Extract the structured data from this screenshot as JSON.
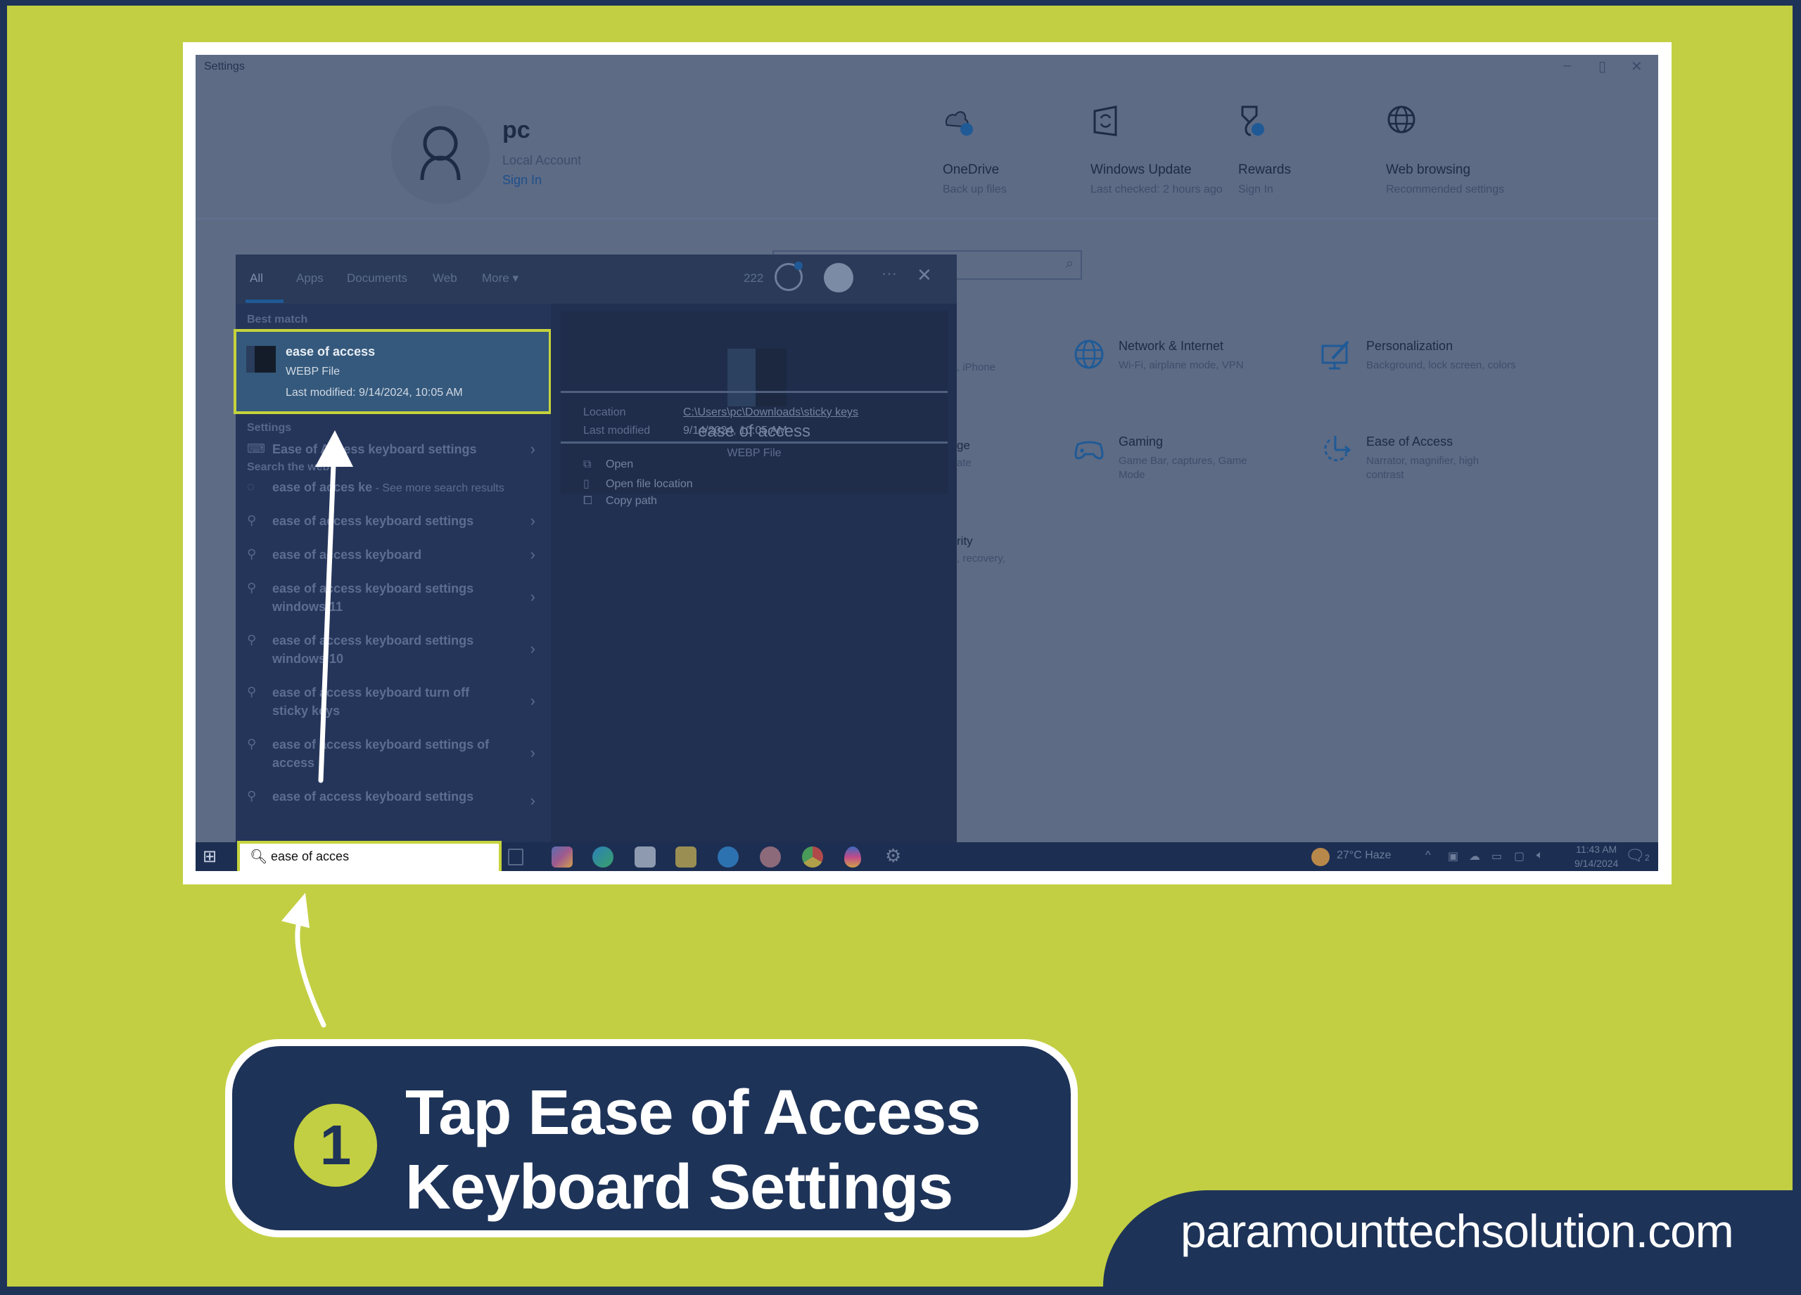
{
  "settings_window": {
    "title": "Settings",
    "controls": {
      "minimize": "–",
      "maximize": "▯",
      "close": "✕"
    },
    "account": {
      "name": "pc",
      "type": "Local Account",
      "sign_in": "Sign In"
    },
    "quick_tiles": [
      {
        "icon": "onedrive-icon",
        "title": "OneDrive",
        "subtitle": "Back up files"
      },
      {
        "icon": "windows-update-icon",
        "title": "Windows Update",
        "subtitle": "Last checked: 2 hours ago"
      },
      {
        "icon": "rewards-icon",
        "title": "Rewards",
        "subtitle": "Sign In"
      },
      {
        "icon": "web-browsing-icon",
        "title": "Web browsing",
        "subtitle": "Recommended settings"
      }
    ],
    "categories": [
      {
        "icon": "globe-icon",
        "title": "Network & Internet",
        "subtitle": "Wi-Fi, airplane mode, VPN"
      },
      {
        "icon": "personalization-icon",
        "title": "Personalization",
        "subtitle": "Background, lock screen, colors"
      },
      {
        "icon": "gamepad-icon",
        "title": "Gaming",
        "subtitle": "Game Bar, captures, Game Mode"
      },
      {
        "icon": "ease-of-access-icon",
        "title": "Ease of Access",
        "subtitle": "Narrator, magnifier, high contrast"
      }
    ],
    "partial_texts": {
      "phone": ", iPhone",
      "apps_title": "ge",
      "apps_sub": "ate",
      "security_title": "rity",
      "security_sub": ", recovery,"
    }
  },
  "search_panel": {
    "tabs": [
      {
        "label": "All",
        "active": true
      },
      {
        "label": "Apps"
      },
      {
        "label": "Documents"
      },
      {
        "label": "Web"
      },
      {
        "label": "More ▾"
      }
    ],
    "points": "222",
    "more_label": "···",
    "close_label": "✕",
    "best_match_header": "Best match",
    "best_match": {
      "title": "ease of access",
      "type": "WEBP File",
      "modified": "Last modified: 9/14/2024, 10:05 AM"
    },
    "settings_header": "Settings",
    "settings_results": [
      {
        "icon": "keyboard-icon",
        "label": "Ease of Access keyboard settings"
      }
    ],
    "web_header": "Search the web",
    "web_results": [
      {
        "icon": "bing-chat-icon",
        "label": "ease of acces ke",
        "suffix": " - See more search results"
      },
      {
        "icon": "search-icon",
        "label": "ease of access keyboard settings"
      },
      {
        "icon": "search-icon",
        "label": "ease of access keyboard"
      },
      {
        "icon": "search-icon",
        "label": "ease of access keyboard settings windows 11"
      },
      {
        "icon": "search-icon",
        "label": "ease of access keyboard settings windows 10"
      },
      {
        "icon": "search-icon",
        "label": "ease of access keyboard turn off sticky keys"
      },
      {
        "icon": "search-icon",
        "label": "ease of access keyboard settings of access"
      },
      {
        "icon": "search-icon",
        "label": "ease of access keyboard settings"
      }
    ],
    "preview": {
      "name": "ease of access",
      "type": "WEBP File",
      "location_label": "Location",
      "location_value": "C:\\Users\\pc\\Downloads\\sticky keys",
      "modified_label": "Last modified",
      "modified_value": "9/14/2024, 10:05 AM",
      "actions": [
        {
          "icon": "open-icon",
          "label": "Open"
        },
        {
          "icon": "folder-location-icon",
          "label": "Open file location"
        },
        {
          "icon": "copy-icon",
          "label": "Copy path"
        }
      ]
    }
  },
  "taskbar": {
    "search_value": "ease of acces",
    "apps": [
      "task-view-icon",
      "copilot-icon",
      "edge-icon",
      "mail-icon",
      "file-explorer-icon",
      "skype-icon",
      "app-icon",
      "chrome-icon",
      "paint-icon",
      "settings-gear-icon"
    ],
    "weather": "27°C  Haze",
    "time": "11:43 AM",
    "date": "9/14/2024",
    "notification_count": "2"
  },
  "callout": {
    "step": "1",
    "line1": "Tap  Ease of Access",
    "line2": "Keyboard Settings"
  },
  "brand": {
    "site": "paramounttechsolution.com"
  },
  "colors": {
    "lime": "#c2cf42",
    "navy": "#1e3358",
    "highlight": "#c5d33c"
  }
}
